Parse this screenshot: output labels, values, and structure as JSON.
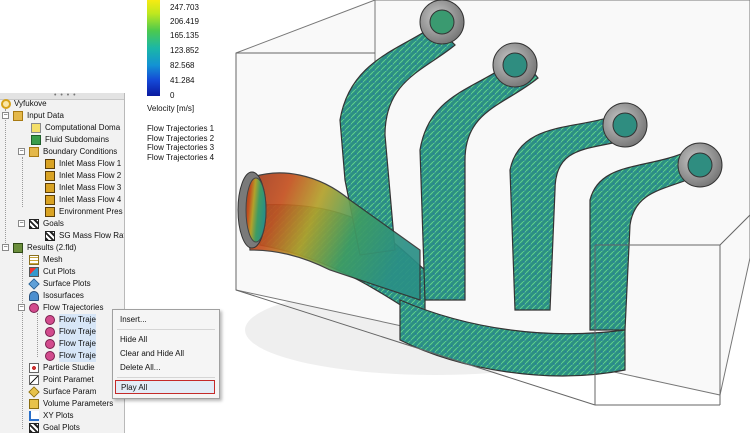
{
  "tree": {
    "items": [
      {
        "label": "Vyfukove",
        "icon": "assembly-icon"
      },
      {
        "label": "Input Data",
        "icon": "folder-icon"
      },
      {
        "label": "Computational Doma",
        "icon": "domain-icon"
      },
      {
        "label": "Fluid Subdomains",
        "icon": "fluid-icon"
      },
      {
        "label": "Boundary Conditions",
        "icon": "folder-icon"
      },
      {
        "label": "Inlet Mass Flow 1",
        "icon": "boundary-icon"
      },
      {
        "label": "Inlet Mass Flow 2",
        "icon": "boundary-icon"
      },
      {
        "label": "Inlet Mass Flow 3",
        "icon": "boundary-icon"
      },
      {
        "label": "Inlet Mass Flow 4",
        "icon": "boundary-icon"
      },
      {
        "label": "Environment Pres",
        "icon": "boundary-icon"
      },
      {
        "label": "Goals",
        "icon": "goals-icon"
      },
      {
        "label": "SG Mass Flow Rat",
        "icon": "goal-icon"
      },
      {
        "label": "Results (2.fld)",
        "icon": "results-icon"
      },
      {
        "label": "Mesh",
        "icon": "mesh-icon"
      },
      {
        "label": "Cut Plots",
        "icon": "cut-plot-icon"
      },
      {
        "label": "Surface Plots",
        "icon": "surface-plot-icon"
      },
      {
        "label": "Isosurfaces",
        "icon": "isosurface-icon"
      },
      {
        "label": "Flow Trajectories",
        "icon": "trajectory-icon"
      },
      {
        "label": "Flow Traje",
        "icon": "trajectory-item-icon"
      },
      {
        "label": "Flow Traje",
        "icon": "trajectory-item-icon"
      },
      {
        "label": "Flow Traje",
        "icon": "trajectory-item-icon"
      },
      {
        "label": "Flow Traje",
        "icon": "trajectory-item-icon"
      },
      {
        "label": "Particle Studie",
        "icon": "particle-icon"
      },
      {
        "label": "Point Paramet",
        "icon": "point-icon"
      },
      {
        "label": "Surface Param",
        "icon": "surface-param-icon"
      },
      {
        "label": "Volume Parameters",
        "icon": "volume-param-icon"
      },
      {
        "label": "XY Plots",
        "icon": "xy-plot-icon"
      },
      {
        "label": "Goal Plots",
        "icon": "goal-plot-icon"
      }
    ]
  },
  "legend": {
    "ticks": [
      "247.703",
      "206.419",
      "165.135",
      "123.852",
      "82.568",
      "41.284",
      "0"
    ],
    "unit": "Velocity [m/s]",
    "colors": [
      "#f7ea12",
      "#4cc94e",
      "#1bb7a6",
      "#1392d4",
      "#0b1a9f"
    ]
  },
  "trajectories": [
    "Flow Trajectories 1",
    "Flow Trajectories 2",
    "Flow Trajectories 3",
    "Flow Trajectories 4"
  ],
  "context_menu": {
    "items": [
      "Insert...",
      "Hide All",
      "Clear and Hide All",
      "Delete All...",
      "Play All"
    ],
    "highlighted": "Play All"
  }
}
